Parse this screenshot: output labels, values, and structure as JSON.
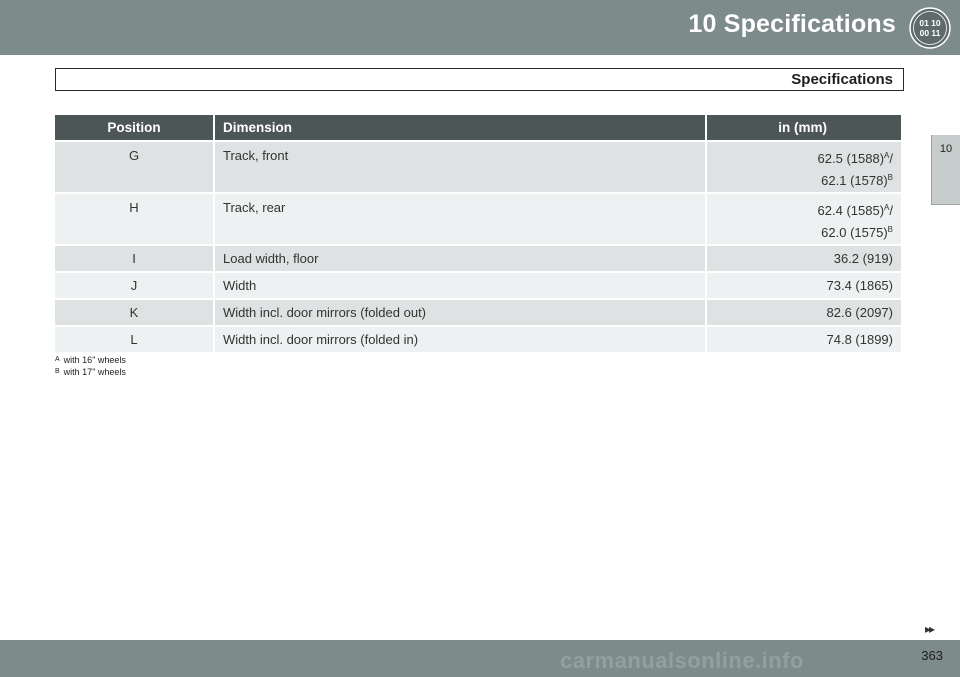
{
  "header": {
    "chapter_title": "10  Specifications",
    "icon": "spec-dial-icon",
    "icon_digits": [
      "01 10",
      "00 11"
    ]
  },
  "side_tab": {
    "label": "10"
  },
  "section": {
    "title": "Specifications"
  },
  "table": {
    "headers": [
      "Position",
      "Dimension",
      "in (mm)"
    ],
    "rows": [
      {
        "position": "G",
        "dimension": "Track, front",
        "values": [
          "62.5 (1588)",
          "62.1 (1578)"
        ],
        "marks": [
          "A",
          "B"
        ],
        "separator": "/"
      },
      {
        "position": "H",
        "dimension": "Track, rear",
        "values": [
          "62.4 (1585)",
          "62.0 (1575)"
        ],
        "marks": [
          "A",
          "B"
        ],
        "separator": "/"
      },
      {
        "position": "I",
        "dimension": "Load width, floor",
        "values": [
          "36.2 (919)"
        ]
      },
      {
        "position": "J",
        "dimension": "Width",
        "values": [
          "73.4 (1865)"
        ]
      },
      {
        "position": "K",
        "dimension": "Width incl. door mirrors (folded out)",
        "values": [
          "82.6 (2097)"
        ]
      },
      {
        "position": "L",
        "dimension": "Width incl. door mirrors (folded in)",
        "values": [
          "74.8 (1899)"
        ]
      }
    ]
  },
  "footnotes": [
    {
      "mark": "A",
      "text": "with 16\" wheels"
    },
    {
      "mark": "B",
      "text": "with 17\" wheels"
    }
  ],
  "footer": {
    "continue_glyph": "▸▸",
    "page_number": "363",
    "watermark": "carmanualsonline.info"
  },
  "colors": {
    "header_bar": "#7d8b8a",
    "table_header": "#4c5657",
    "row_dark": "#dfe2e2",
    "row_light": "#eef1f1"
  }
}
